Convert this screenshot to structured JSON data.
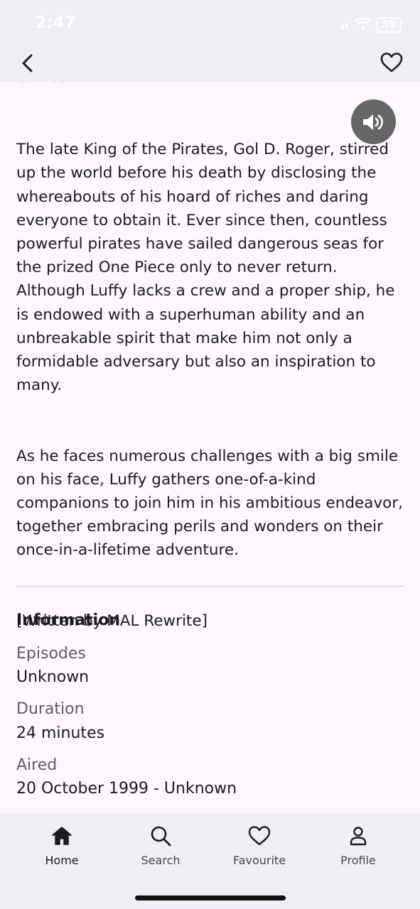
{
  "status_bar": {
    "time": "2:47",
    "battery": "59",
    "icons": [
      "signal-icon",
      "wifi-icon",
      "battery-icon"
    ]
  },
  "top_bar": {
    "back_icon": "chevron-left-icon",
    "favourite_icon": "heart-outline-icon"
  },
  "description": {
    "cut_line": "comes with it.",
    "paragraph1": "The late King of the Pirates, Gol D. Roger, stirred up the world before his death by disclosing the whereabouts of his hoard of riches and daring everyone to obtain it. Ever since then, countless powerful pirates have sailed dangerous seas for the prized One Piece only to never return. Although Luffy lacks a crew and a proper ship, he is endowed with a superhuman ability and an unbreakable spirit that make him not only a formidable adversary but also an inspiration to many.",
    "paragraph2": "As he faces numerous challenges with a big smile on his face, Luffy gathers one-of-a-kind companions to join him in his ambitious endeavor, together embracing perils and wonders on their once-in-a-lifetime adventure.",
    "credit": "[Written by MAL Rewrite]"
  },
  "information": {
    "title": "Information",
    "episodes_label": "Episodes",
    "episodes_value": "Unknown",
    "duration_label": "Duration",
    "duration_value": "24 minutes",
    "aired_label": "Aired",
    "aired_value": "20 October 1999 - Unknown"
  },
  "floating": {
    "speaker_icon": "speaker-volume-icon"
  },
  "bottom_nav": {
    "items": [
      {
        "label": "Home",
        "icon": "home-icon",
        "active": true
      },
      {
        "label": "Search",
        "icon": "search-icon",
        "active": false
      },
      {
        "label": "Favourite",
        "icon": "heart-outline-icon",
        "active": false
      },
      {
        "label": "Profile",
        "icon": "person-icon",
        "active": false
      }
    ]
  },
  "colors": {
    "background": "#fcf8fd",
    "bars": "#f1edf4",
    "text": "#1c1b20",
    "muted": "#5e5b63"
  }
}
